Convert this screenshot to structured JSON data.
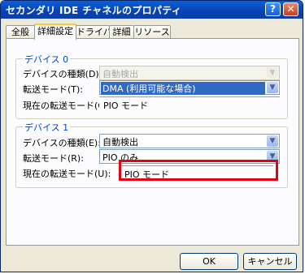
{
  "window": {
    "title": "セカンダリ IDE チャネルのプロパティ"
  },
  "titlebar_buttons": {
    "help": "?",
    "close": "✕"
  },
  "tabs": [
    {
      "label": "全般"
    },
    {
      "label": "詳細設定"
    },
    {
      "label": "ドライバ"
    },
    {
      "label": "詳細"
    },
    {
      "label": "リソース"
    }
  ],
  "device0": {
    "title": "デバイス 0",
    "type_label": "デバイスの種類(D):",
    "type_value": "自動検出",
    "mode_label": "転送モード(T):",
    "mode_value": "DMA (利用可能な場合)",
    "current_label": "現在の転送モード(C):",
    "current_value": "PIO モード"
  },
  "device1": {
    "title": "デバイス 1",
    "type_label": "デバイスの種類(E):",
    "type_value": "自動検出",
    "mode_label": "転送モード(R):",
    "mode_value": "PIO のみ",
    "current_label": "現在の転送モード(U):",
    "current_value": "PIO モード"
  },
  "buttons": {
    "ok": "OK",
    "cancel": "キャンセル"
  },
  "icons": {
    "dropdown": "▼"
  },
  "colors": {
    "title_bar": "#0842b3",
    "group_title": "#0046d5",
    "highlight_box": "#e60012",
    "selection": "#316ac5"
  }
}
